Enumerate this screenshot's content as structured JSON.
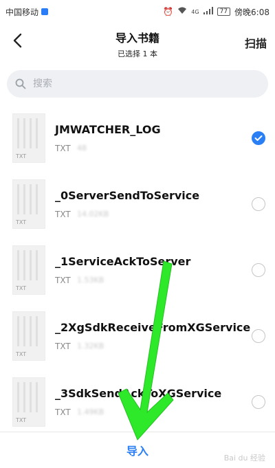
{
  "status_bar": {
    "carrier": "中国移动",
    "network": "4G",
    "battery": "77",
    "time_text": "傍晚6:08"
  },
  "header": {
    "title": "导入书籍",
    "subtitle": "已选择 1 本",
    "scan_label": "扫描",
    "back_icon": "chevron-left-icon"
  },
  "search": {
    "placeholder": "搜索",
    "value": "",
    "icon": "search-icon"
  },
  "files": [
    {
      "name": "JMWATCHER_LOG",
      "type": "TXT",
      "size": "48",
      "thumb_label": "TXT",
      "checked": true
    },
    {
      "name": "_0ServerSendToService",
      "type": "TXT",
      "size": "14.02KB",
      "thumb_label": "TXT",
      "checked": false
    },
    {
      "name": "_1ServiceAckToServer",
      "type": "TXT",
      "size": "1.53KB",
      "thumb_label": "TXT",
      "checked": false
    },
    {
      "name": "_2XgSdkReceiveFromXGService",
      "type": "TXT",
      "size": "1.32KB",
      "thumb_label": "TXT",
      "checked": false
    },
    {
      "name": "_3SdkSendAckToXGService",
      "type": "TXT",
      "size": "1.49KB",
      "thumb_label": "TXT",
      "checked": false
    }
  ],
  "footer": {
    "import_label": "导入"
  },
  "watermark": "Bai du 经验",
  "colors": {
    "accent": "#2b7ff5",
    "annotation_arrow": "#2ee82a"
  }
}
